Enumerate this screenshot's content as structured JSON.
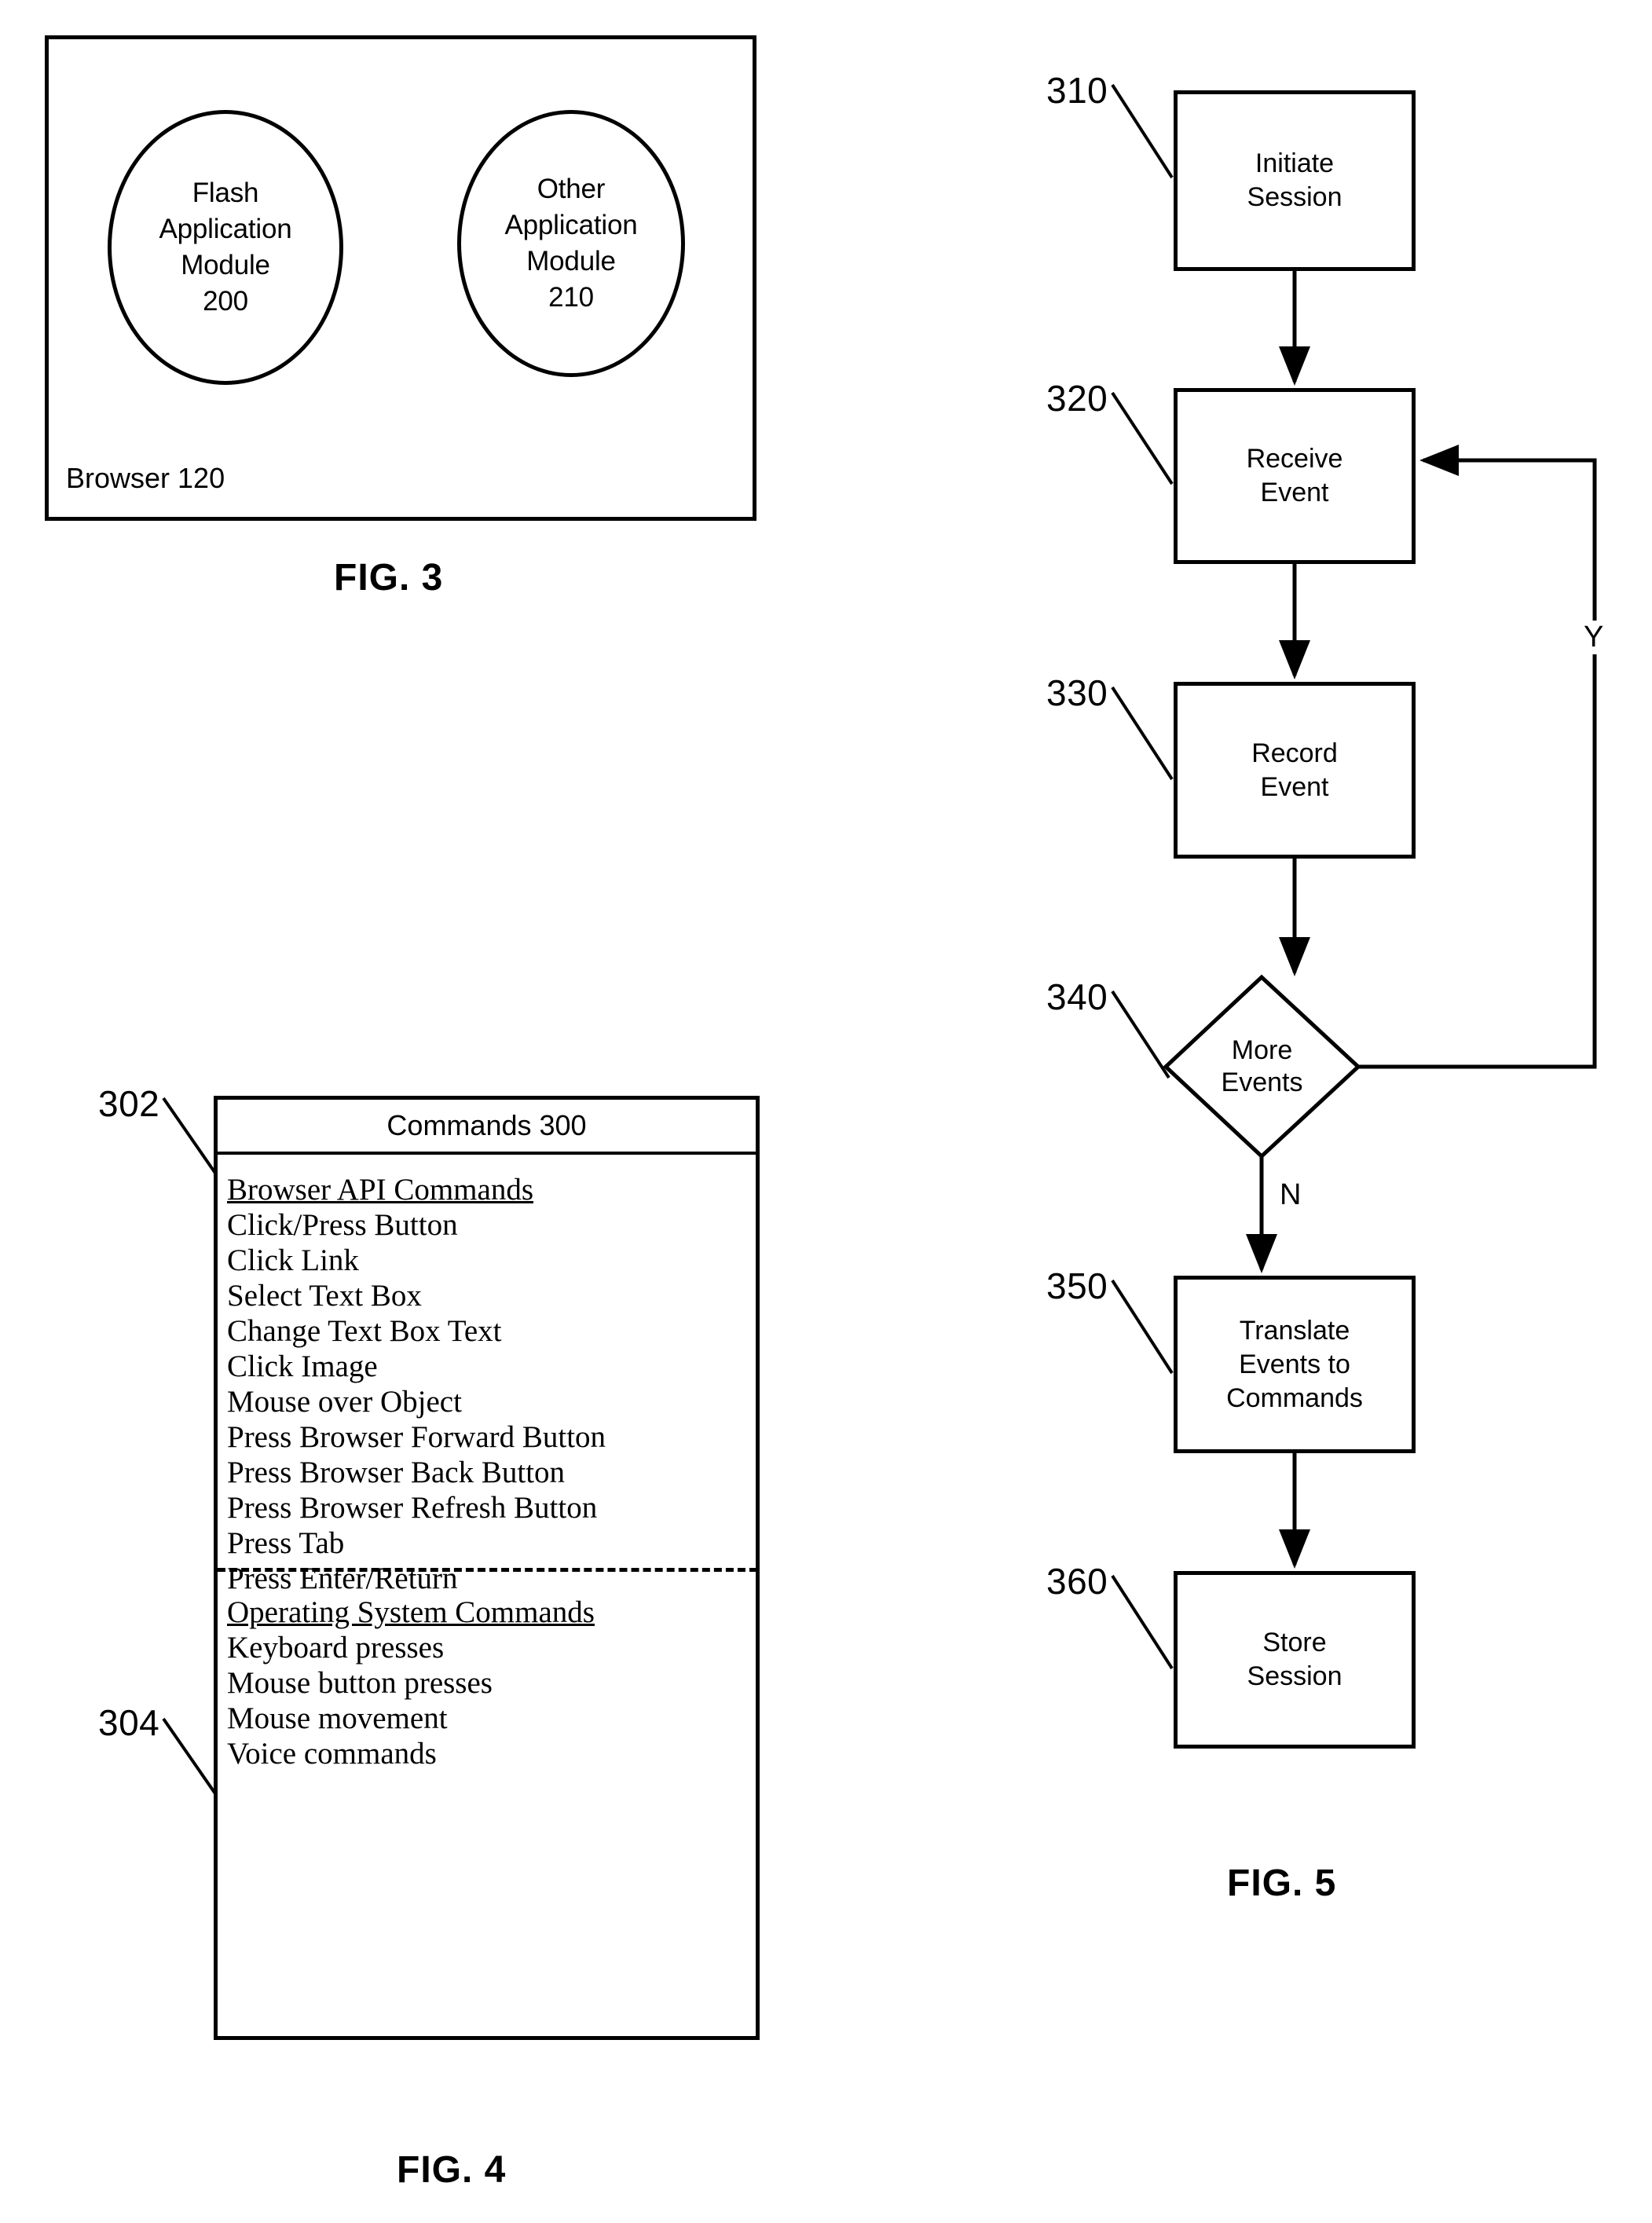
{
  "figures": {
    "fig3": {
      "caption": "FIG. 3",
      "container_label": "Browser 120",
      "modules": [
        {
          "ref": "200",
          "lines": [
            "Flash",
            "Application",
            "Module",
            "200"
          ]
        },
        {
          "ref": "210",
          "lines": [
            "Other",
            "Application",
            "Module",
            "210"
          ]
        }
      ]
    },
    "fig4": {
      "caption": "FIG. 4",
      "title": "Commands 300",
      "ref_302": "302",
      "ref_304": "304",
      "groups": [
        {
          "heading": "Browser API Commands",
          "items": [
            "Click/Press Button",
            "Click Link",
            "Select Text Box",
            "Change Text Box Text",
            "Click Image",
            "Mouse over Object",
            "Press Browser Forward Button",
            "Press Browser Back Button",
            "Press Browser Refresh Button",
            "Press Tab",
            "Press Enter/Return"
          ]
        },
        {
          "heading": "Operating System Commands",
          "items": [
            "Keyboard presses",
            "Mouse button presses",
            "Mouse movement",
            "Voice commands"
          ]
        }
      ]
    },
    "fig5": {
      "caption": "FIG. 5",
      "steps": [
        {
          "ref": "310",
          "lines": [
            "Initiate",
            "Session"
          ],
          "shape": "process"
        },
        {
          "ref": "320",
          "lines": [
            "Receive",
            "Event"
          ],
          "shape": "process"
        },
        {
          "ref": "330",
          "lines": [
            "Record",
            "Event"
          ],
          "shape": "process"
        },
        {
          "ref": "340",
          "lines": [
            "More",
            "Events"
          ],
          "shape": "decision"
        },
        {
          "ref": "350",
          "lines": [
            "Translate",
            "Events to",
            "Commands"
          ],
          "shape": "process"
        },
        {
          "ref": "360",
          "lines": [
            "Store",
            "Session"
          ],
          "shape": "process"
        }
      ],
      "branch_yes": "Y",
      "branch_no": "N"
    }
  },
  "colors": {
    "ink": "#000000",
    "paper": "#ffffff"
  }
}
